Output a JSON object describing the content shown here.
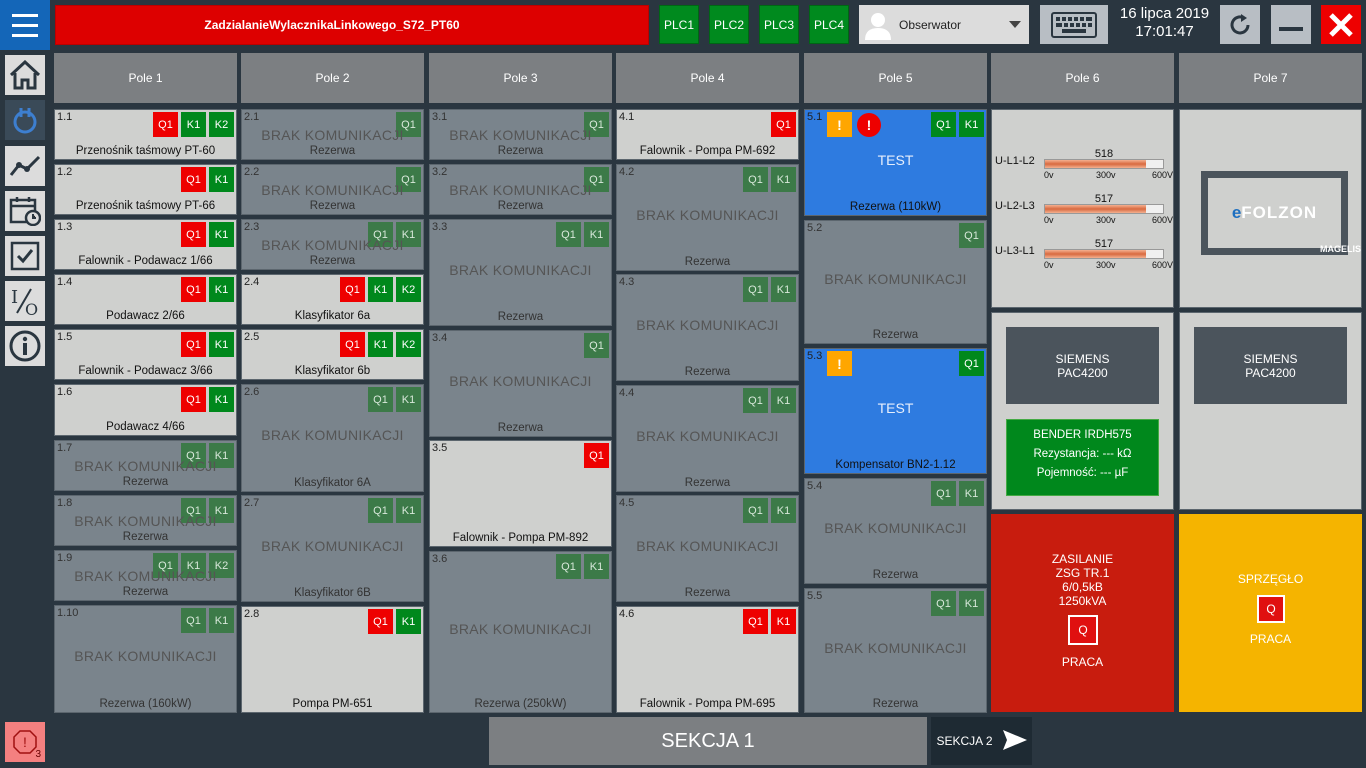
{
  "header": {
    "alarm_text": "ZadzialanieWylacznikaLinkowego_S72_PT60",
    "plc": [
      "PLC1",
      "PLC2",
      "PLC3",
      "PLC4"
    ],
    "user": "Obserwator",
    "date": "16 lipca 2019",
    "time": "17:01:47"
  },
  "columns": [
    "Pole 1",
    "Pole 2",
    "Pole 3",
    "Pole 4",
    "Pole 5",
    "Pole 6",
    "Pole 7"
  ],
  "no_comm": "BRAK KOMUNIKACJI",
  "tiles": {
    "t11": {
      "num": "1.1",
      "name": "Przenośnik taśmowy PT-60",
      "b": [
        "Q1",
        "K1",
        "K2"
      ]
    },
    "t12": {
      "num": "1.2",
      "name": "Przenośnik taśmowy PT-66",
      "b": [
        "Q1",
        "K1"
      ]
    },
    "t13": {
      "num": "1.3",
      "name": "Falownik - Podawacz 1/66",
      "b": [
        "Q1",
        "K1"
      ]
    },
    "t14": {
      "num": "1.4",
      "name": "Podawacz 2/66",
      "b": [
        "Q1",
        "K1"
      ]
    },
    "t15": {
      "num": "1.5",
      "name": "Falownik - Podawacz 3/66",
      "b": [
        "Q1",
        "K1"
      ]
    },
    "t16": {
      "num": "1.6",
      "name": "Podawacz 4/66",
      "b": [
        "Q1",
        "K1"
      ]
    },
    "t17": {
      "num": "1.7",
      "name": "Rezerwa",
      "b": [
        "Q1",
        "K1"
      ]
    },
    "t18": {
      "num": "1.8",
      "name": "Rezerwa",
      "b": [
        "Q1",
        "K1"
      ]
    },
    "t19": {
      "num": "1.9",
      "name": "Rezerwa",
      "b": [
        "Q1",
        "K1",
        "K2"
      ]
    },
    "t110": {
      "num": "1.10",
      "name": "Rezerwa (160kW)",
      "b": [
        "Q1",
        "K1"
      ]
    },
    "t21": {
      "num": "2.1",
      "name": "Rezerwa",
      "b": [
        "Q1"
      ]
    },
    "t22": {
      "num": "2.2",
      "name": "Rezerwa",
      "b": [
        "Q1"
      ]
    },
    "t23": {
      "num": "2.3",
      "name": "Rezerwa",
      "b": [
        "Q1",
        "K1"
      ]
    },
    "t24": {
      "num": "2.4",
      "name": "Klasyfikator 6a",
      "b": [
        "Q1",
        "K1",
        "K2"
      ]
    },
    "t25": {
      "num": "2.5",
      "name": "Klasyfikator 6b",
      "b": [
        "Q1",
        "K1",
        "K2"
      ]
    },
    "t26": {
      "num": "2.6",
      "name": "Klasyfikator 6A",
      "b": [
        "Q1",
        "K1"
      ]
    },
    "t27": {
      "num": "2.7",
      "name": "Klasyfikator 6B",
      "b": [
        "Q1",
        "K1"
      ]
    },
    "t28": {
      "num": "2.8",
      "name": "Pompa PM-651",
      "b": [
        "Q1",
        "K1"
      ]
    },
    "t31": {
      "num": "3.1",
      "name": "Rezerwa",
      "b": [
        "Q1"
      ]
    },
    "t32": {
      "num": "3.2",
      "name": "Rezerwa",
      "b": [
        "Q1"
      ]
    },
    "t33": {
      "num": "3.3",
      "name": "Rezerwa",
      "b": [
        "Q1",
        "K1"
      ]
    },
    "t34": {
      "num": "3.4",
      "name": "Rezerwa",
      "b": [
        "Q1"
      ]
    },
    "t35": {
      "num": "3.5",
      "name": "Falownik - Pompa PM-892",
      "b": [
        "Q1"
      ]
    },
    "t36": {
      "num": "3.6",
      "name": "Rezerwa (250kW)",
      "b": [
        "Q1",
        "K1"
      ]
    },
    "t41": {
      "num": "4.1",
      "name": "Falownik - Pompa PM-692",
      "b": [
        "Q1"
      ]
    },
    "t42": {
      "num": "4.2",
      "name": "Rezerwa",
      "b": [
        "Q1",
        "K1"
      ]
    },
    "t43": {
      "num": "4.3",
      "name": "Rezerwa",
      "b": [
        "Q1",
        "K1"
      ]
    },
    "t44": {
      "num": "4.4",
      "name": "Rezerwa",
      "b": [
        "Q1",
        "K1"
      ]
    },
    "t45": {
      "num": "4.5",
      "name": "Rezerwa",
      "b": [
        "Q1",
        "K1"
      ]
    },
    "t46": {
      "num": "4.6",
      "name": "Falownik - Pompa PM-695",
      "b": [
        "Q1",
        "K1"
      ]
    },
    "t51": {
      "num": "5.1",
      "name": "Rezerwa (110kW)",
      "b": [
        "Q1",
        "K1"
      ],
      "test": "TEST"
    },
    "t52": {
      "num": "5.2",
      "name": "Rezerwa",
      "b": [
        "Q1"
      ]
    },
    "t53": {
      "num": "5.3",
      "name": "Kompensator BN2-1.12",
      "b": [
        "Q1"
      ],
      "test": "TEST"
    },
    "t54": {
      "num": "5.4",
      "name": "Rezerwa",
      "b": [
        "Q1",
        "K1"
      ]
    },
    "t55": {
      "num": "5.5",
      "name": "Rezerwa",
      "b": [
        "Q1",
        "K1"
      ]
    }
  },
  "pole6": {
    "meters": [
      {
        "label": "U-L1-L2",
        "value": "518",
        "fraction": 0.86
      },
      {
        "label": "U-L2-L3",
        "value": "517",
        "fraction": 0.86
      },
      {
        "label": "U-L3-L1",
        "value": "517",
        "fraction": 0.86
      }
    ],
    "scale": [
      "0v",
      "300v",
      "600V"
    ],
    "siemens": [
      "SIEMENS",
      "PAC4200"
    ],
    "bender": {
      "title": "BENDER IRDH575",
      "r": "Rezystancja: --- kΩ",
      "c": "Pojemność: --- µF"
    },
    "zasilanie": [
      "ZASILANIE",
      "ZSG TR.1",
      "6/0,5kB",
      "1250kVA"
    ],
    "zas_q": "Q",
    "zas_state": "PRACA"
  },
  "pole7": {
    "logo_e": "e",
    "logo_rest": "FOLZON",
    "logo_sub": "MAGELIS",
    "siemens": [
      "SIEMENS",
      "PAC4200"
    ],
    "sprzeglo": "SPRZĘGŁO",
    "q": "Q",
    "state": "PRACA"
  },
  "footer": {
    "current": "SEKCJA 1",
    "next": "SEKCJA 2"
  },
  "alarm_count": "3",
  "colors": {
    "red": "#ee0000",
    "green": "#00881c",
    "blue": "#2e7be0",
    "orange": "#ffa600",
    "zasilanie": "#c81c0e",
    "sprzeglo": "#f5b400"
  }
}
